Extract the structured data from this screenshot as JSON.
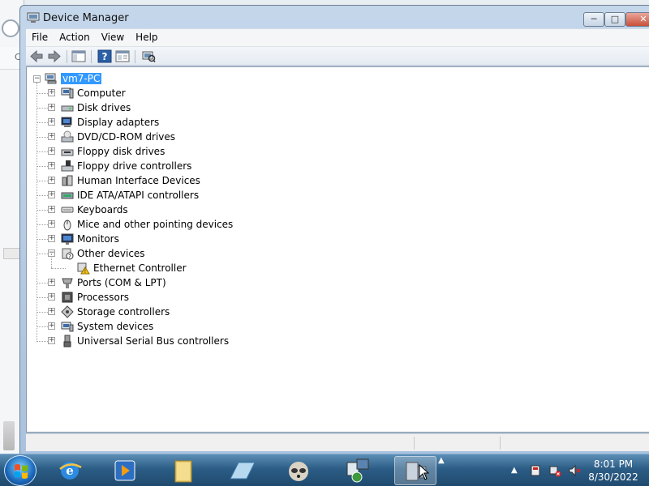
{
  "window": {
    "title": "Device Manager",
    "min_label": "─",
    "max_label": "□",
    "close_label": "✕"
  },
  "menu": {
    "file": "File",
    "action": "Action",
    "view": "View",
    "help": "Help"
  },
  "toolbar": {
    "buttons": [
      "back-icon",
      "forward-icon",
      "show-hide-console-tree-icon",
      "help-icon",
      "properties-icon",
      "scan-hardware-icon"
    ]
  },
  "tree": {
    "root": "vm7-PC",
    "items": [
      {
        "label": "Computer",
        "icon": "computer-icon",
        "expanded": false
      },
      {
        "label": "Disk drives",
        "icon": "disk-drive-icon",
        "expanded": false
      },
      {
        "label": "Display adapters",
        "icon": "display-adapter-icon",
        "expanded": false
      },
      {
        "label": "DVD/CD-ROM drives",
        "icon": "dvd-drive-icon",
        "expanded": false
      },
      {
        "label": "Floppy disk drives",
        "icon": "floppy-drive-icon",
        "expanded": false
      },
      {
        "label": "Floppy drive controllers",
        "icon": "floppy-controller-icon",
        "expanded": false
      },
      {
        "label": "Human Interface Devices",
        "icon": "hid-icon",
        "expanded": false
      },
      {
        "label": "IDE ATA/ATAPI controllers",
        "icon": "ide-controller-icon",
        "expanded": false
      },
      {
        "label": "Keyboards",
        "icon": "keyboard-icon",
        "expanded": false
      },
      {
        "label": "Mice and other pointing devices",
        "icon": "mouse-icon",
        "expanded": false
      },
      {
        "label": "Monitors",
        "icon": "monitor-icon",
        "expanded": false
      },
      {
        "label": "Other devices",
        "icon": "unknown-device-icon",
        "expanded": true,
        "children": [
          {
            "label": "Ethernet Controller",
            "icon": "warning-device-icon"
          }
        ]
      },
      {
        "label": "Ports (COM & LPT)",
        "icon": "port-icon",
        "expanded": false
      },
      {
        "label": "Processors",
        "icon": "processor-icon",
        "expanded": false
      },
      {
        "label": "Storage controllers",
        "icon": "storage-controller-icon",
        "expanded": false
      },
      {
        "label": "System devices",
        "icon": "system-device-icon",
        "expanded": false
      },
      {
        "label": "Universal Serial Bus controllers",
        "icon": "usb-icon",
        "expanded": false
      }
    ]
  },
  "taskbar": {
    "buttons": [
      "internet-explorer-icon",
      "media-player-icon",
      "file-explorer-icon",
      "notepad-icon",
      "raccoon-app-icon",
      "network-tool-icon",
      "device-manager-icon"
    ],
    "clock_time": "8:01 PM",
    "clock_date": "8/30/2022"
  },
  "colors": {
    "selection": "#3399ff",
    "taskbar": "#2c5d86"
  }
}
